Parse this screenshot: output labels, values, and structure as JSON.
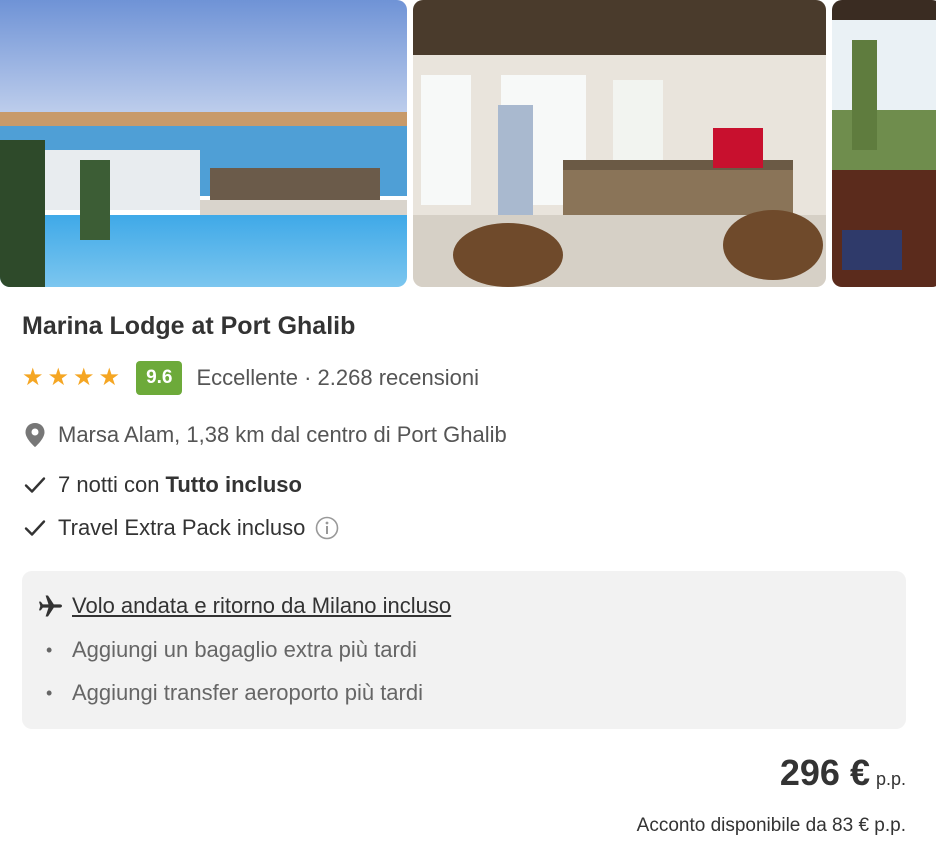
{
  "hotel": {
    "name": "Marina Lodge at Port Ghalib",
    "stars": 4,
    "score": "9.6",
    "rating_text": "Eccellente · 2.268 recensioni",
    "location": "Marsa Alam, 1,38 km dal centro di Port Ghalib"
  },
  "features": {
    "nights_prefix": "7 notti con",
    "nights_board": "Tutto incluso",
    "extra_pack": "Travel Extra Pack incluso"
  },
  "flight": {
    "main": "Volo andata e ritorno da Milano incluso",
    "options": [
      "Aggiungi un bagaglio extra più tardi",
      "Aggiungi transfer aeroporto più tardi"
    ]
  },
  "price": {
    "value": "296 €",
    "unit": "p.p.",
    "deposit": "Acconto disponibile da 83 € p.p."
  },
  "colors": {
    "score_badge": "#6DAA3A",
    "star": "#F5A623",
    "box_bg": "#f2f2f2"
  },
  "icons": [
    "star-icon",
    "location-pin-icon",
    "check-icon",
    "info-icon",
    "airplane-icon"
  ]
}
